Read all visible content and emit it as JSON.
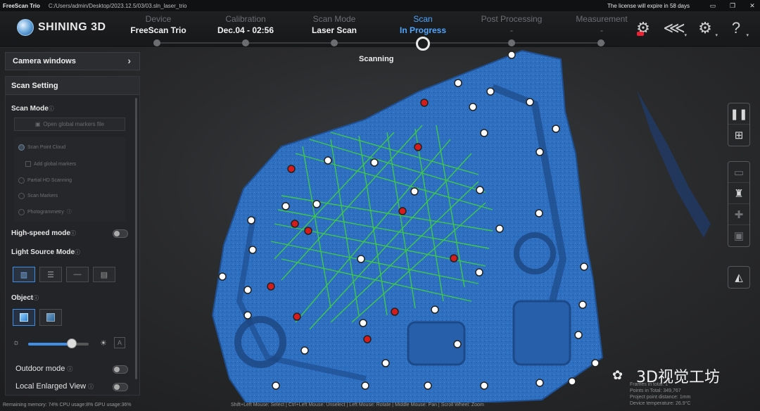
{
  "titlebar": {
    "app_name": "FreeScan Trio",
    "path": "C:/Users/admin/Desktop/2023.12.5/03/03.sln_laser_trio",
    "license": "The license will expire in 58 days"
  },
  "header": {
    "brand": "SHINING 3D",
    "steps": [
      {
        "caption": "Device",
        "value": "FreeScan Trio"
      },
      {
        "caption": "Calibration",
        "value": "Dec.04 - 02:56"
      },
      {
        "caption": "Scan Mode",
        "value": "Laser Scan"
      },
      {
        "caption": "Scan",
        "value": "In Progress"
      },
      {
        "caption": "Post Processing",
        "value": "-"
      },
      {
        "caption": "Measurement",
        "value": "-"
      }
    ]
  },
  "left_panel": {
    "camera_windows": "Camera windows",
    "scan_setting": "Scan Setting",
    "scan_mode_label": "Scan Mode",
    "open_markers": "Open global markers file",
    "options": {
      "scan_point_cloud": "Scan Point Cloud",
      "add_global_markers": "Add global markers",
      "partial_hd": "Partial HD Scanning",
      "scan_markers": "Scan Markers",
      "photogrammetry": "Photogrammetry"
    },
    "high_speed": "High-speed mode",
    "light_source": "Light Source Mode",
    "object": "Object",
    "outdoor": "Outdoor mode",
    "local_enlarged": "Local Enlarged View",
    "brightness": 0.72
  },
  "viewport": {
    "title": "Scanning"
  },
  "status": {
    "left": "Remaining memory: 74% CPU usage:8% GPU usage:36%",
    "mid": "Shift+Left Mouse: Select | Ctrl+Left Mouse: Unselect | Left Mouse: Rotate | Middle Mouse: Pan | Scroll Wheel: Zoom",
    "frames": "Frames in total: 1",
    "points": "Points in Total: 349,767",
    "distance": "Project point distance: 1mm",
    "temperature": "Device temperature: 26.9°C"
  },
  "watermark": "3D视觉工坊",
  "colors": {
    "accent": "#4fa5ff",
    "scan_blue": "#2f6fc0",
    "laser_green": "#3fd23f",
    "marker_red": "#d41c1c"
  }
}
